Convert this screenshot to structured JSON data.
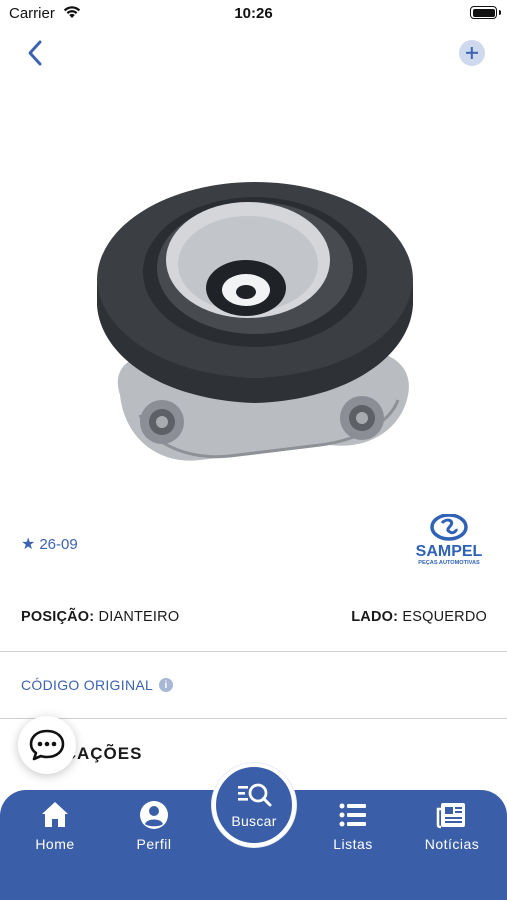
{
  "status_bar": {
    "carrier": "Carrier",
    "time": "10:26"
  },
  "product": {
    "rating": "26-09",
    "brand": {
      "name": "SAMPEL",
      "tagline": "PEÇAS AUTOMOTIVAS"
    },
    "position_label": "POSIÇÃO:",
    "position_value": "DIANTEIRO",
    "side_label": "LADO:",
    "side_value": "ESQUERDO",
    "codigo_label": "CÓDIGO ORIGINAL",
    "aplicacoes_label": "APLICAÇÕES"
  },
  "tabbar": {
    "home": "Home",
    "perfil": "Perfil",
    "buscar": "Buscar",
    "listas": "Listas",
    "noticias": "Notícias"
  },
  "colors": {
    "accent": "#3b5ea8",
    "link": "#3c63b0"
  }
}
